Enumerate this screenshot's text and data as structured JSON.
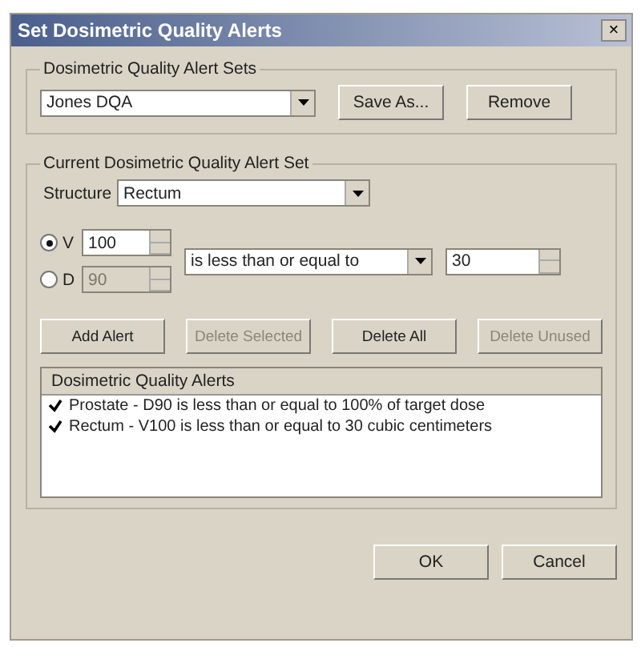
{
  "window": {
    "title": "Set Dosimetric Quality Alerts",
    "close": "×"
  },
  "alert_sets": {
    "legend": "Dosimetric Quality Alert Sets",
    "value": "Jones DQA",
    "buttons": [
      {
        "label": "Save As...",
        "disabled": false
      },
      {
        "label": "Remove",
        "disabled": false
      }
    ]
  },
  "current_set": {
    "legend": "Current Dosimetric Quality Alert Set",
    "structure_label": "Structure",
    "structure": "Rectum",
    "metrics": [
      {
        "label": "V",
        "selected": true,
        "value": "100",
        "disabled": false
      },
      {
        "label": "D",
        "selected": false,
        "value": "90",
        "disabled": true
      }
    ],
    "operator": "is less than or equal to",
    "threshold": "30",
    "buttons": [
      {
        "label": "Add Alert",
        "disabled": false
      },
      {
        "label": "Delete Selected",
        "disabled": true
      },
      {
        "label": "Delete All",
        "disabled": false
      },
      {
        "label": "Delete Unused",
        "disabled": true
      }
    ],
    "alerts_header": "Dosimetric Quality Alerts",
    "alerts": [
      {
        "text": "Prostate - D90 is less than or equal to 100% of target dose",
        "checked": true
      },
      {
        "text": "Rectum - V100 is less than or equal to 30 cubic centimeters",
        "checked": true
      }
    ]
  },
  "footer_buttons": [
    "OK",
    "Cancel"
  ]
}
